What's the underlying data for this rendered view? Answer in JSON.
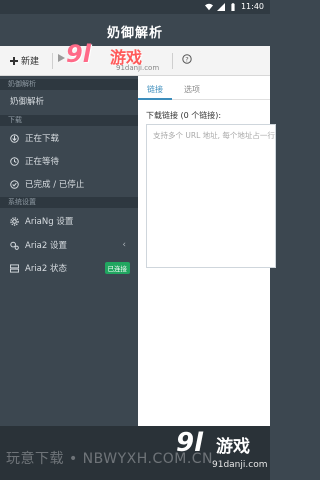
{
  "status_bar": {
    "time": "11:40"
  },
  "app_bar": {
    "title": "奶御解析"
  },
  "toolbar": {
    "new_label": "新建",
    "help_icon": "help-icon"
  },
  "watermark": {
    "top_logo": "9l",
    "top_cn": "游戏",
    "top_url": "91danji.com",
    "bottom_text": "玩意下载 • NBWYXH.COM.CN",
    "bottom_logo": "9l",
    "bottom_cn": "游戏",
    "bottom_url": "91danji.com"
  },
  "sidebar": {
    "section_app": "奶御解析",
    "item_app": "奶御解析",
    "section_download": "下载",
    "downloading": "正在下载",
    "waiting": "正在等待",
    "stopped": "已完成 / 已停止",
    "section_settings": "系统设置",
    "ariang_settings": "AriaNg 设置",
    "aria2_settings": "Aria2 设置",
    "aria2_status": "Aria2 状态",
    "aria2_status_badge": "已连接"
  },
  "main": {
    "tab_links": "链接",
    "tab_options": "选项",
    "links_label": "下载链接 (0 个链接):",
    "url_placeholder": "支持多个 URL 地址, 每个地址占一行."
  },
  "colors": {
    "sidebar_bg": "#3c4750",
    "accent": "#3c8dbc",
    "badge": "#21a660"
  }
}
